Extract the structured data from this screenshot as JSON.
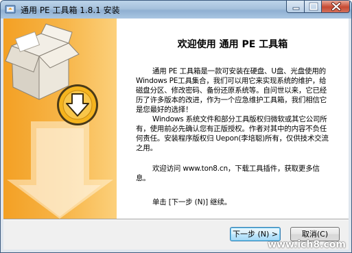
{
  "window": {
    "title": "通用 PE 工具箱 1.8.1 安装"
  },
  "welcome": {
    "heading": "欢迎使用 通用 PE 工具箱",
    "paragraphs": [
      "通用 PE 工具箱是一款可安装在硬盘、U盘、光盘使用的Windows PE工具集合，我们可以用它来实现系统的维护，给磁盘分区、修改密码、备份还原系统等。自问世以来，它已经历了许多版本的改进，作为一个应急维护工具箱，我们相信它是您最好的选择！",
      "Windows 系统文件和部分工具版权归微软或其它公司所有，使用前必先确认您有正版授权。作者对其中的内容不负任何责任。安装程序版权归 Uepon(李培聪)所有，仅供技术交流之用。",
      "欢迎访问 www.ton8.cn，下载工具插件，获取更多信息。",
      "单击 [下一步 (N)] 继续。"
    ]
  },
  "buttons": {
    "next": "下一步 (N) >",
    "cancel": "取消(C)"
  },
  "watermark": "www.ich8.com",
  "colors": {
    "panel_orange": "#f7b64a",
    "title_blue": "#a6c1dc"
  }
}
